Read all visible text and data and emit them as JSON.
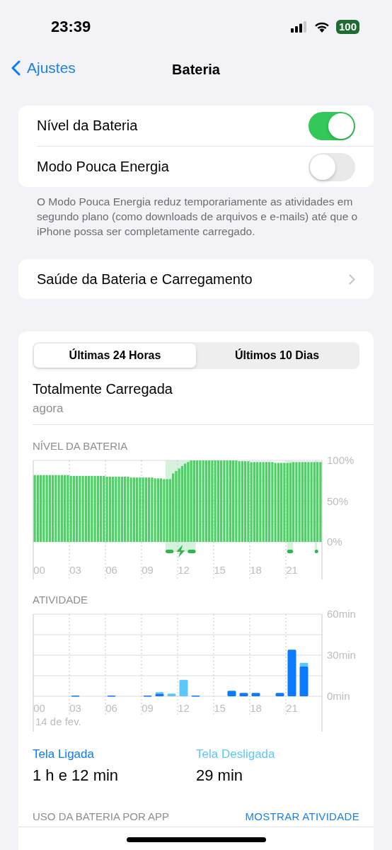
{
  "status_bar": {
    "time": "23:39",
    "battery": "100"
  },
  "nav": {
    "back": "Ajustes",
    "title": "Bateria"
  },
  "settings": [
    {
      "label": "Nível da Bateria",
      "on": true
    },
    {
      "label": "Modo Pouca Energia",
      "on": false
    }
  ],
  "settings_note": "O Modo Pouca Energia reduz temporariamente as atividades em segundo plano (como downloads de arquivos e e-mails) até que o iPhone possa ser completamente carregado.",
  "health_row": {
    "label": "Saúde da Bateria e Carregamento"
  },
  "usage": {
    "tabs": [
      {
        "label": "Últimas 24 Horas",
        "selected": true
      },
      {
        "label": "Últimos 10 Dias",
        "selected": false
      }
    ],
    "status": {
      "title": "Totalmente Carregada",
      "subtitle": "agora"
    },
    "battery_chart": {
      "heading": "NÍVEL DA BATERIA",
      "chart_data": {
        "type": "bar",
        "xlim": [
          0,
          24
        ],
        "ylim": [
          0,
          100
        ],
        "x": [
          0,
          0.25,
          0.5,
          0.75,
          1,
          1.25,
          1.5,
          1.75,
          2,
          2.25,
          2.5,
          2.75,
          3,
          3.25,
          3.5,
          3.75,
          4,
          4.25,
          4.5,
          4.75,
          5,
          5.25,
          5.5,
          5.75,
          6,
          6.25,
          6.5,
          6.75,
          7,
          7.25,
          7.5,
          7.75,
          8,
          8.25,
          8.5,
          8.75,
          9,
          9.25,
          9.5,
          9.75,
          10,
          10.25,
          10.5,
          10.75,
          11,
          11.25,
          11.5,
          11.75,
          12,
          12.25,
          12.5,
          12.75,
          13,
          13.25,
          13.5,
          13.75,
          14,
          14.25,
          14.5,
          14.75,
          15,
          15.25,
          15.5,
          15.75,
          16,
          16.25,
          16.5,
          16.75,
          17,
          17.25,
          17.5,
          17.75,
          18,
          18.25,
          18.5,
          18.75,
          19,
          19.25,
          19.5,
          19.75,
          20,
          20.25,
          20.5,
          20.75,
          21,
          21.25,
          21.5,
          21.75,
          22,
          22.25,
          22.5,
          22.75,
          23,
          23.25,
          23.5,
          23.75
        ],
        "values": [
          82,
          82,
          82,
          82,
          82,
          82,
          82,
          82,
          82,
          82,
          82,
          82,
          81,
          81,
          81,
          81,
          81,
          81,
          81,
          81,
          81,
          81,
          81,
          81,
          80,
          80,
          80,
          80,
          80,
          80,
          80,
          80,
          79,
          79,
          79,
          79,
          79,
          79,
          79,
          79,
          78,
          78,
          78,
          77,
          77,
          77,
          84,
          87,
          90,
          93,
          96,
          98,
          100,
          100,
          100,
          100,
          100,
          100,
          100,
          100,
          100,
          100,
          100,
          100,
          100,
          100,
          100,
          100,
          99,
          99,
          99,
          99,
          98,
          98,
          98,
          98,
          98,
          98,
          98,
          98,
          97,
          97,
          97,
          97,
          97,
          97,
          98,
          98,
          98,
          98,
          98,
          98,
          98,
          98,
          98,
          98
        ],
        "xticks": [
          {
            "value": 0.5,
            "label": "00"
          },
          {
            "value": 3.5,
            "label": "03"
          },
          {
            "value": 6.5,
            "label": "06"
          },
          {
            "value": 9.5,
            "label": "09"
          },
          {
            "value": 12.5,
            "label": "12"
          },
          {
            "value": 15.5,
            "label": "15"
          },
          {
            "value": 18.5,
            "label": "18"
          },
          {
            "value": 21.5,
            "label": "21"
          }
        ],
        "yticks": [
          {
            "value": 0,
            "label": "0%"
          },
          {
            "value": 50,
            "label": "50%"
          },
          {
            "value": 100,
            "label": "100%"
          }
        ]
      }
    },
    "activity_chart": {
      "heading": "ATIVIDADE",
      "date": "14 de fev.",
      "chart_data": {
        "type": "bar",
        "stacked": true,
        "ylim": [
          0,
          60
        ],
        "xlim": [
          0,
          24
        ],
        "x": [
          0.5,
          1.5,
          2.5,
          3.5,
          4.5,
          5.5,
          6.5,
          7.5,
          8.5,
          9.5,
          10.5,
          11.5,
          12.5,
          13.5,
          14.5,
          15.5,
          16.5,
          17.5,
          18.5,
          19.5,
          20.5,
          21.5,
          22.5,
          23.5
        ],
        "series": [
          {
            "name": "Tela Ligada",
            "color": "#0a7aff",
            "values": [
              0,
              0,
              0,
              0.5,
              0,
              0,
              0.5,
              0,
              0,
              0.5,
              2,
              0,
              0,
              0.5,
              0,
              0,
              4,
              2.5,
              2.5,
              0,
              2.5,
              34,
              22,
              0
            ]
          },
          {
            "name": "Tela Desligada",
            "color": "#5ac8fa",
            "values": [
              0,
              0,
              0,
              0,
              0,
              0,
              0,
              0,
              0,
              0,
              1,
              2,
              12,
              0,
              0,
              0,
              0,
              0,
              0,
              0,
              0,
              0,
              2.5,
              0
            ]
          }
        ],
        "xticks": [
          {
            "value": 0.5,
            "label": "00"
          },
          {
            "value": 3.5,
            "label": "03"
          },
          {
            "value": 6.5,
            "label": "06"
          },
          {
            "value": 9.5,
            "label": "09"
          },
          {
            "value": 12.5,
            "label": "12"
          },
          {
            "value": 15.5,
            "label": "15"
          },
          {
            "value": 18.5,
            "label": "18"
          },
          {
            "value": 21.5,
            "label": "21"
          }
        ],
        "yticks": [
          {
            "value": 0,
            "label": "0min"
          },
          {
            "value": 30,
            "label": "30min"
          },
          {
            "value": 60,
            "label": "60min"
          }
        ]
      }
    },
    "stats": [
      {
        "value": "1 h e 12 min"
      },
      {
        "value": "29 min"
      }
    ],
    "app_usage": {
      "heading": "USO DA BATERIA POR APP",
      "action": "MOSTRAR ATIVIDADE"
    }
  }
}
